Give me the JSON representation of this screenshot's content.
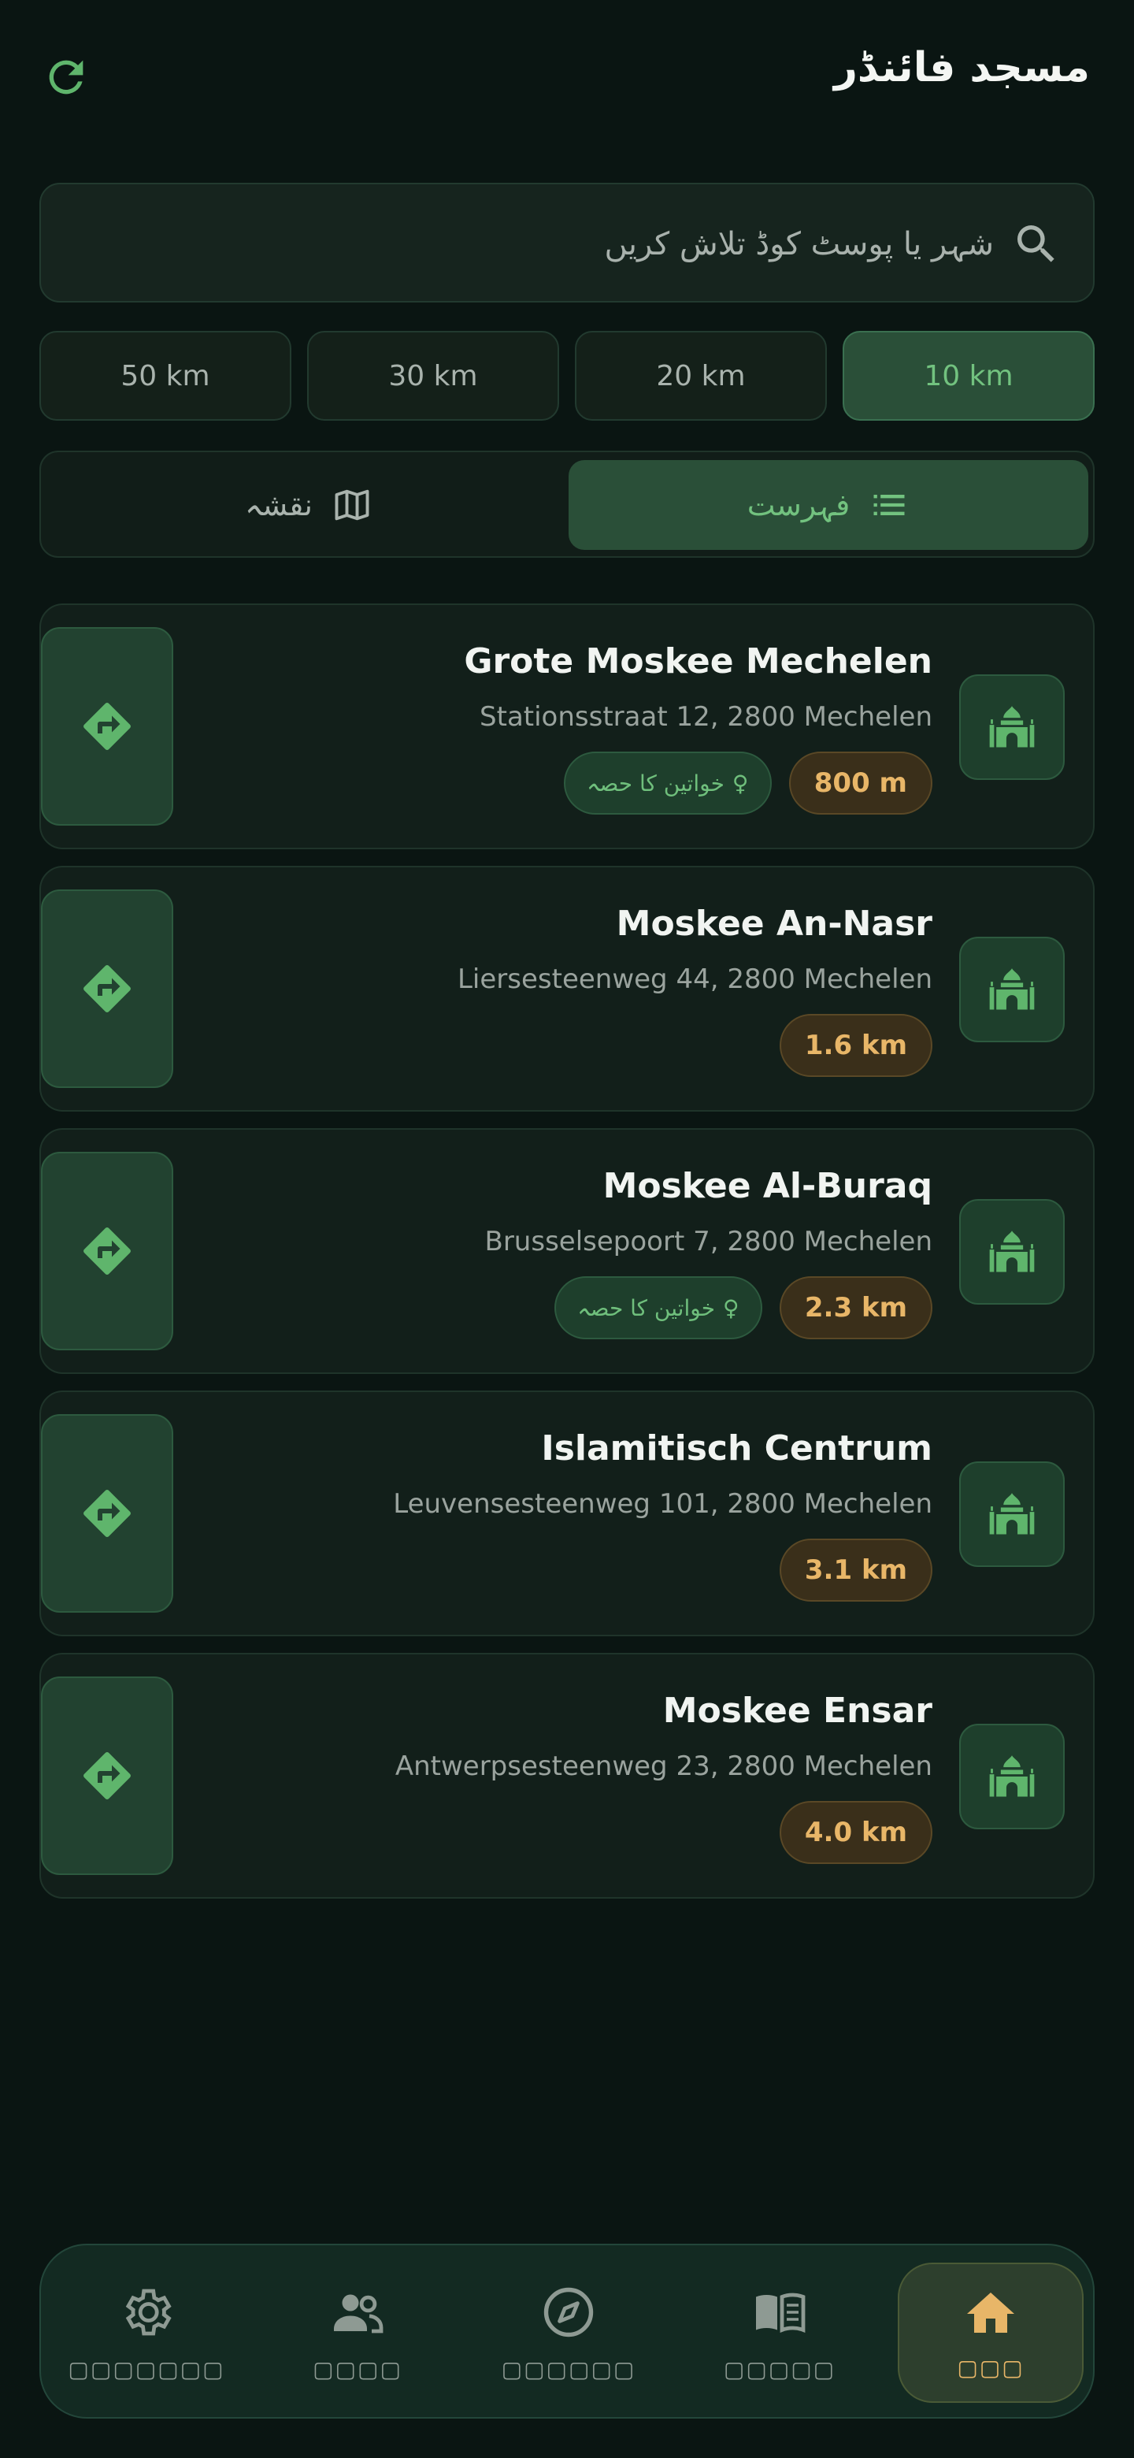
{
  "header": {
    "title": "مسجد فائنڈر",
    "refresh_icon": "refresh-icon"
  },
  "search": {
    "placeholder": "شہر یا پوسٹ کوڈ تلاش کریں",
    "value": ""
  },
  "radius": {
    "options": [
      "50 km",
      "30 km",
      "20 km",
      "10 km"
    ],
    "selected": "10 km"
  },
  "view_toggle": {
    "map_label": "نقشہ",
    "list_label": "فہرست",
    "selected": "list"
  },
  "mosques": [
    {
      "name": "Grote Moskee Mechelen",
      "address": "Stationsstraat 12, 2800 Mechelen",
      "distance": "800 m",
      "women_section": true
    },
    {
      "name": "Moskee An-Nasr",
      "address": "Liersesteenweg 44, 2800 Mechelen",
      "distance": "1.6 km",
      "women_section": false
    },
    {
      "name": "Moskee Al-Buraq",
      "address": "Brusselsepoort 7, 2800 Mechelen",
      "distance": "2.3 km",
      "women_section": true
    },
    {
      "name": "Islamitisch Centrum",
      "address": "Leuvensesteenweg 101, 2800 Mechelen",
      "distance": "3.1 km",
      "women_section": false
    },
    {
      "name": "Moskee Ensar",
      "address": "Antwerpsesteenweg 23, 2800 Mechelen",
      "distance": "4.0 km",
      "women_section": false
    }
  ],
  "women_badge_label": "خواتین کا حصہ",
  "nav": {
    "items": [
      {
        "label": "▢▢▢▢▢▢▢",
        "icon": "gear-icon"
      },
      {
        "label": "▢▢▢▢",
        "icon": "people-icon"
      },
      {
        "label": "▢▢▢▢▢▢",
        "icon": "compass-icon"
      },
      {
        "label": "▢▢▢▢▢",
        "icon": "book-icon"
      },
      {
        "label": "▢▢▢",
        "icon": "home-icon"
      }
    ],
    "active": 4
  },
  "colors": {
    "accent_green": "#72c27f",
    "accent_gold": "#e8b668",
    "background": "#0a1512"
  }
}
